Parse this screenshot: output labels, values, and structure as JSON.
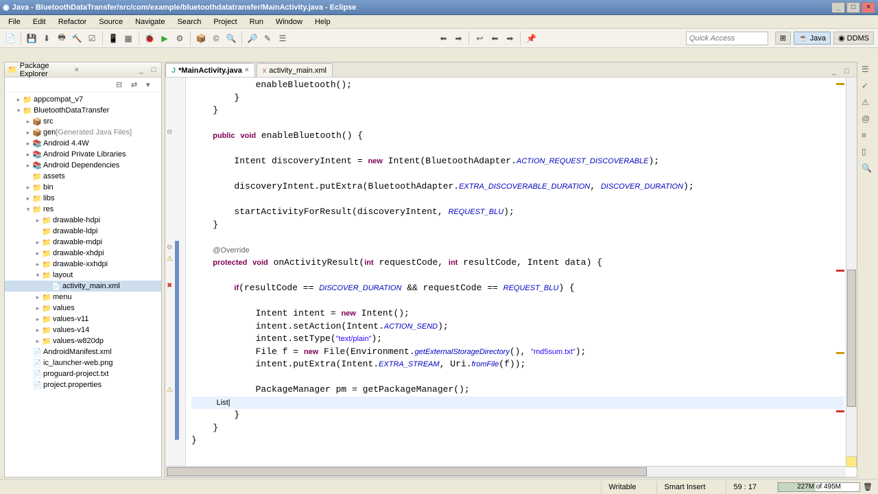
{
  "title": "Java - BluetoothDataTransfer/src/com/example/bluetoothdatatransfer/MainActivity.java - Eclipse",
  "menus": [
    "File",
    "Edit",
    "Refactor",
    "Source",
    "Navigate",
    "Search",
    "Project",
    "Run",
    "Window",
    "Help"
  ],
  "quick_access": "Quick Access",
  "perspectives": {
    "java": "Java",
    "ddms": "DDMS"
  },
  "package_explorer": {
    "title": "Package Explorer",
    "items": [
      {
        "ind": 1,
        "exp": "▸",
        "icon": "proj",
        "label": "appcompat_v7"
      },
      {
        "ind": 1,
        "exp": "▾",
        "icon": "proj",
        "label": "BluetoothDataTransfer"
      },
      {
        "ind": 2,
        "exp": "▸",
        "icon": "pkg",
        "label": "src"
      },
      {
        "ind": 2,
        "exp": "▸",
        "icon": "pkg",
        "label": "gen",
        "suffix": " [Generated Java Files]"
      },
      {
        "ind": 2,
        "exp": "▸",
        "icon": "lib",
        "label": "Android 4.4W"
      },
      {
        "ind": 2,
        "exp": "▸",
        "icon": "lib",
        "label": "Android Private Libraries"
      },
      {
        "ind": 2,
        "exp": "▸",
        "icon": "lib",
        "label": "Android Dependencies"
      },
      {
        "ind": 2,
        "exp": "",
        "icon": "fold",
        "label": "assets"
      },
      {
        "ind": 2,
        "exp": "▸",
        "icon": "fold",
        "label": "bin"
      },
      {
        "ind": 2,
        "exp": "▸",
        "icon": "fold",
        "label": "libs"
      },
      {
        "ind": 2,
        "exp": "▾",
        "icon": "fold",
        "label": "res"
      },
      {
        "ind": 3,
        "exp": "▸",
        "icon": "fold",
        "label": "drawable-hdpi"
      },
      {
        "ind": 3,
        "exp": "",
        "icon": "fold",
        "label": "drawable-ldpi"
      },
      {
        "ind": 3,
        "exp": "▸",
        "icon": "fold",
        "label": "drawable-mdpi"
      },
      {
        "ind": 3,
        "exp": "▸",
        "icon": "fold",
        "label": "drawable-xhdpi"
      },
      {
        "ind": 3,
        "exp": "▸",
        "icon": "fold",
        "label": "drawable-xxhdpi"
      },
      {
        "ind": 3,
        "exp": "▾",
        "icon": "fold",
        "label": "layout"
      },
      {
        "ind": 4,
        "exp": "",
        "icon": "file",
        "label": "activity_main.xml",
        "sel": true
      },
      {
        "ind": 3,
        "exp": "▸",
        "icon": "fold",
        "label": "menu"
      },
      {
        "ind": 3,
        "exp": "▸",
        "icon": "fold",
        "label": "values"
      },
      {
        "ind": 3,
        "exp": "▸",
        "icon": "fold",
        "label": "values-v11"
      },
      {
        "ind": 3,
        "exp": "▸",
        "icon": "fold",
        "label": "values-v14"
      },
      {
        "ind": 3,
        "exp": "▸",
        "icon": "fold",
        "label": "values-w820dp"
      },
      {
        "ind": 2,
        "exp": "",
        "icon": "file",
        "label": "AndroidManifest.xml"
      },
      {
        "ind": 2,
        "exp": "",
        "icon": "file",
        "label": "ic_launcher-web.png"
      },
      {
        "ind": 2,
        "exp": "",
        "icon": "file",
        "label": "proguard-project.txt"
      },
      {
        "ind": 2,
        "exp": "",
        "icon": "file",
        "label": "project.properties"
      }
    ]
  },
  "tabs": [
    {
      "label": "*MainActivity.java",
      "active": true
    },
    {
      "label": "activity_main.xml",
      "active": false
    }
  ],
  "status": {
    "writable": "Writable",
    "insert": "Smart Insert",
    "pos": "59 : 17",
    "mem": "227M of 495M"
  },
  "code_lines": [
    "            enableBluetooth();",
    "        }",
    "    }",
    "",
    "    public void enableBluetooth() {",
    "",
    "        Intent discoveryIntent = new Intent(BluetoothAdapter.ACTION_REQUEST_DISCOVERABLE);",
    "",
    "        discoveryIntent.putExtra(BluetoothAdapter.EXTRA_DISCOVERABLE_DURATION, DISCOVER_DURATION);",
    "",
    "        startActivityForResult(discoveryIntent, REQUEST_BLU);",
    "    }",
    "",
    "    @Override",
    "    protected void onActivityResult(int requestCode, int resultCode, Intent data) {",
    "",
    "        if(resultCode == DISCOVER_DURATION && requestCode == REQUEST_BLU) {",
    "",
    "            Intent intent = new Intent();",
    "            intent.setAction(Intent.ACTION_SEND);",
    "            intent.setType(\"text/plain\");",
    "            File f = new File(Environment.getExternalStorageDirectory(), \"md5sum.txt\");",
    "            intent.putExtra(Intent.EXTRA_STREAM, Uri.fromFile(f));",
    "",
    "            PackageManager pm = getPackageManager();",
    "            List|",
    "        }",
    "    }",
    "}"
  ]
}
